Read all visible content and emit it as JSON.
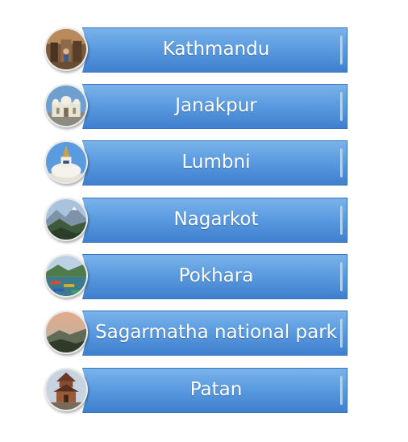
{
  "places": [
    {
      "label": "Kathmandu",
      "icon": "street-market-photo-icon"
    },
    {
      "label": "Janakpur",
      "icon": "temple-photo-icon"
    },
    {
      "label": "Lumbni",
      "icon": "stupa-photo-icon"
    },
    {
      "label": "Nagarkot",
      "icon": "mountain-view-photo-icon"
    },
    {
      "label": "Pokhara",
      "icon": "lake-boats-photo-icon"
    },
    {
      "label": "Sagarmatha national park",
      "icon": "mountain-sunset-photo-icon"
    },
    {
      "label": "Patan",
      "icon": "pagoda-photo-icon"
    }
  ],
  "colors": {
    "bar_top": "#7ab3ea",
    "bar_bottom": "#3f80cf",
    "bar_border": "#3a73b8",
    "label_text": "#ffffff"
  }
}
